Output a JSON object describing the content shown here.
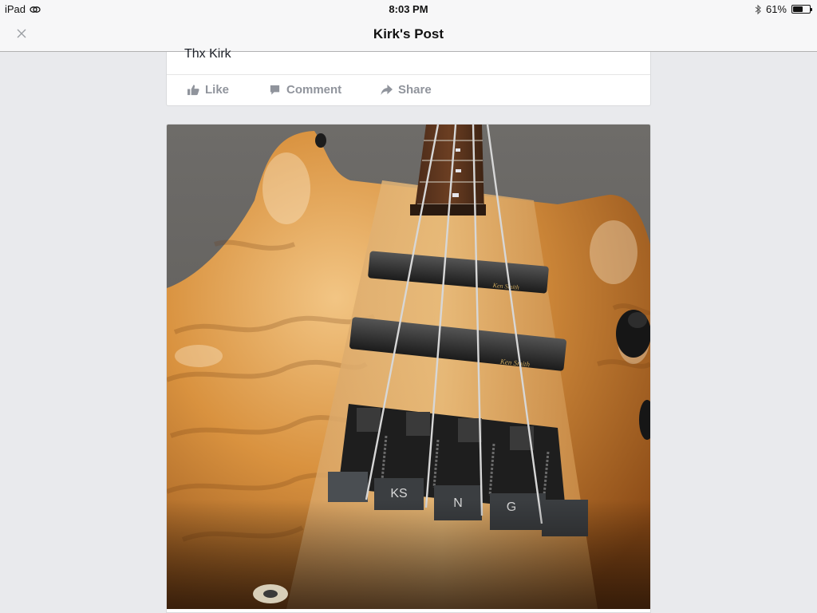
{
  "status_bar": {
    "device": "iPad",
    "time": "8:03 PM",
    "battery_percent": "61%",
    "battery_level": 0.61
  },
  "nav": {
    "title": "Kirk's Post",
    "close_icon": "close-icon"
  },
  "previous_post": {
    "text": "Thx Kirk",
    "actions": {
      "like": "Like",
      "comment": "Comment",
      "share": "Share"
    }
  },
  "photo_post": {
    "pickup_brand": "Ken Smith",
    "bridge_letters": [
      "KS",
      "N",
      "G"
    ]
  },
  "colors": {
    "background": "#e9eaed",
    "action_gray": "#90949c"
  }
}
